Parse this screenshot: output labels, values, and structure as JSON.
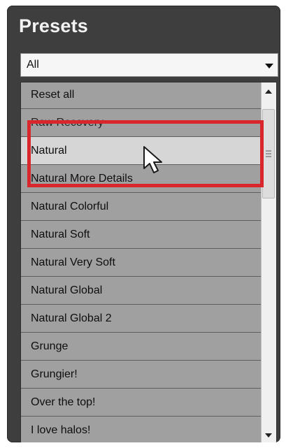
{
  "panel": {
    "title": "Presets"
  },
  "filter": {
    "selected": "All"
  },
  "presets": [
    "Reset all",
    "Raw Recovery",
    "Natural",
    "Natural More Details",
    "Natural Colorful",
    "Natural Soft",
    "Natural Very Soft",
    "Natural Global",
    "Natural Global 2",
    "Grunge",
    "Grungier!",
    "Over the top!",
    "I love halos!"
  ],
  "selected_preset": "Natural",
  "colors": {
    "panel_bg": "#3e3e3e",
    "row_bg": "#a0a0a0",
    "row_selected_bg": "#d6d6d6",
    "annotation_box": "#d8262c"
  },
  "icons": {
    "dropdown": "chevron-down-icon",
    "scroll_up": "scroll-up-arrow-icon",
    "scroll_down": "scroll-down-arrow-icon",
    "cursor": "mouse-pointer-icon"
  }
}
